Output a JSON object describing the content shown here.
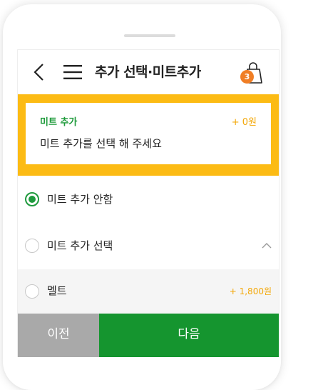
{
  "header": {
    "title": "추가 선택·미트추가",
    "cart_count": "3"
  },
  "summary": {
    "label": "미트 추가",
    "price": "+ 0원",
    "text": "미트 추가를 선택 해 주세요"
  },
  "options": [
    {
      "label": "미트 추가 안함",
      "selected": true
    },
    {
      "label": "미트 추가 선택",
      "selected": false,
      "expanded": true
    }
  ],
  "sub_options": [
    {
      "label": "멜트",
      "price": "+ 1,800원",
      "selected": false
    }
  ],
  "footer": {
    "prev_label": "이전",
    "next_label": "다음"
  },
  "colors": {
    "accent_green": "#15952f",
    "highlight_yellow": "#fcbb14",
    "badge_orange": "#f07e25",
    "price_yellow": "#f3a80a"
  }
}
